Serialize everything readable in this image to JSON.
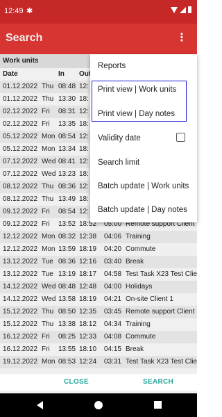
{
  "status": {
    "time": "12:49",
    "settings_glyph": "✱"
  },
  "toolbar": {
    "title": "Search",
    "more_glyph": "⋮"
  },
  "section": {
    "title": "Work units"
  },
  "columns": {
    "date": "Date",
    "in": "In",
    "out": "Out"
  },
  "rows": [
    {
      "date": "01.12.2022",
      "dow": "Thu",
      "in": "08:48",
      "out": "12:",
      "dur": "",
      "desc": ""
    },
    {
      "date": "01.12.2022",
      "dow": "Thu",
      "in": "13:30",
      "out": "18:",
      "dur": "",
      "desc": ""
    },
    {
      "date": "02.12.2022",
      "dow": "Fri",
      "in": "08:31",
      "out": "12:",
      "dur": "",
      "desc": ""
    },
    {
      "date": "02.12.2022",
      "dow": "Fri",
      "in": "13:35",
      "out": "18:",
      "dur": "",
      "desc": ""
    },
    {
      "date": "05.12.2022",
      "dow": "Mon",
      "in": "08:54",
      "out": "12:",
      "dur": "",
      "desc": ""
    },
    {
      "date": "05.12.2022",
      "dow": "Mon",
      "in": "13:34",
      "out": "18:",
      "dur": "",
      "desc": ""
    },
    {
      "date": "07.12.2022",
      "dow": "Wed",
      "in": "08:41",
      "out": "12:",
      "dur": "",
      "desc": ""
    },
    {
      "date": "07.12.2022",
      "dow": "Wed",
      "in": "13:23",
      "out": "18:",
      "dur": "",
      "desc": ""
    },
    {
      "date": "08.12.2022",
      "dow": "Thu",
      "in": "08:36",
      "out": "12:",
      "dur": "",
      "desc": ""
    },
    {
      "date": "08.12.2022",
      "dow": "Thu",
      "in": "13:49",
      "out": "18:",
      "dur": "",
      "desc": ""
    },
    {
      "date": "09.12.2022",
      "dow": "Fri",
      "in": "08:54",
      "out": "12:",
      "dur": "",
      "desc": ""
    },
    {
      "date": "09.12.2022",
      "dow": "Fri",
      "in": "13:52",
      "out": "18:52",
      "dur": "05:00",
      "desc": "Remote support Client"
    },
    {
      "date": "12.12.2022",
      "dow": "Mon",
      "in": "08:32",
      "out": "12:38",
      "dur": "04:06",
      "desc": "Training"
    },
    {
      "date": "12.12.2022",
      "dow": "Mon",
      "in": "13:59",
      "out": "18:19",
      "dur": "04:20",
      "desc": "Commute"
    },
    {
      "date": "13.12.2022",
      "dow": "Tue",
      "in": "08:36",
      "out": "12:16",
      "dur": "03:40",
      "desc": "Break"
    },
    {
      "date": "13.12.2022",
      "dow": "Tue",
      "in": "13:19",
      "out": "18:17",
      "dur": "04:58",
      "desc": "Test Task X23 Test Clie"
    },
    {
      "date": "14.12.2022",
      "dow": "Wed",
      "in": "08:48",
      "out": "12:48",
      "dur": "04:00",
      "desc": "Holidays"
    },
    {
      "date": "14.12.2022",
      "dow": "Wed",
      "in": "13:58",
      "out": "18:19",
      "dur": "04:21",
      "desc": "On-site Client 1"
    },
    {
      "date": "15.12.2022",
      "dow": "Thu",
      "in": "08:50",
      "out": "12:35",
      "dur": "03:45",
      "desc": "Remote support Client"
    },
    {
      "date": "15.12.2022",
      "dow": "Thu",
      "in": "13:38",
      "out": "18:12",
      "dur": "04:34",
      "desc": "Training"
    },
    {
      "date": "16.12.2022",
      "dow": "Fri",
      "in": "08:25",
      "out": "12:33",
      "dur": "04:08",
      "desc": "Commute"
    },
    {
      "date": "16.12.2022",
      "dow": "Fri",
      "in": "13:55",
      "out": "18:10",
      "dur": "04:15",
      "desc": "Break"
    },
    {
      "date": "19.12.2022",
      "dow": "Mon",
      "in": "08:53",
      "out": "12:24",
      "dur": "03:31",
      "desc": "Test Task X23 Test Clie"
    }
  ],
  "menu": {
    "items": [
      "Reports",
      "Print view | Work units",
      "Print view | Day notes",
      "Validity date",
      "Search limit",
      "Batch update | Work units",
      "Batch update | Day notes"
    ],
    "validity_checked": false
  },
  "actions": {
    "close": "CLOSE",
    "search": "SEARCH"
  },
  "colors": {
    "statusbar": "#c62828",
    "toolbar": "#e53935",
    "accent": "#26a69a",
    "highlight": "#1a1ad6"
  }
}
